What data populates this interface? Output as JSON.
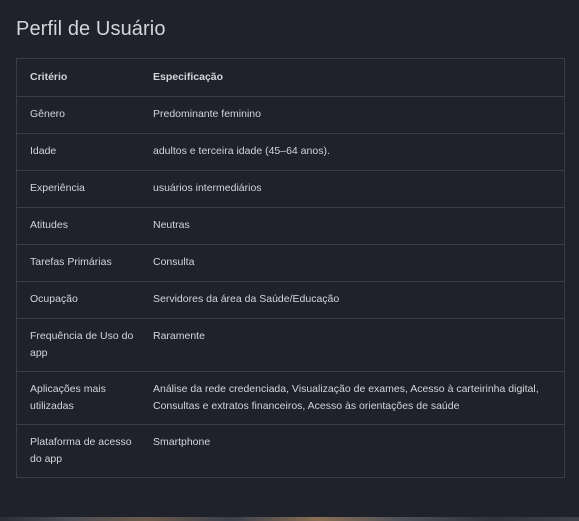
{
  "page": {
    "title": "Perfil de Usuário"
  },
  "table": {
    "headers": [
      "Critério",
      "Especificação"
    ],
    "rows": [
      [
        "Gênero",
        "Predominante feminino"
      ],
      [
        "Idade",
        "adultos e terceira idade (45–64 anos)."
      ],
      [
        "Experiência",
        "usuários intermediários"
      ],
      [
        "Atitudes",
        "Neutras"
      ],
      [
        "Tarefas Primárias",
        "Consulta"
      ],
      [
        "Ocupação",
        "Servidores da área da Saúde/Educação"
      ],
      [
        "Frequência de Uso do app",
        "Raramente"
      ],
      [
        "Aplicações mais utilizadas",
        "Análise da rede credenciada, Visualização de exames, Acesso à carteirinha digital, Consultas e extratos financeiros, Acesso às orientações de saúde"
      ],
      [
        "Plataforma de acesso do app",
        "Smartphone"
      ]
    ]
  }
}
